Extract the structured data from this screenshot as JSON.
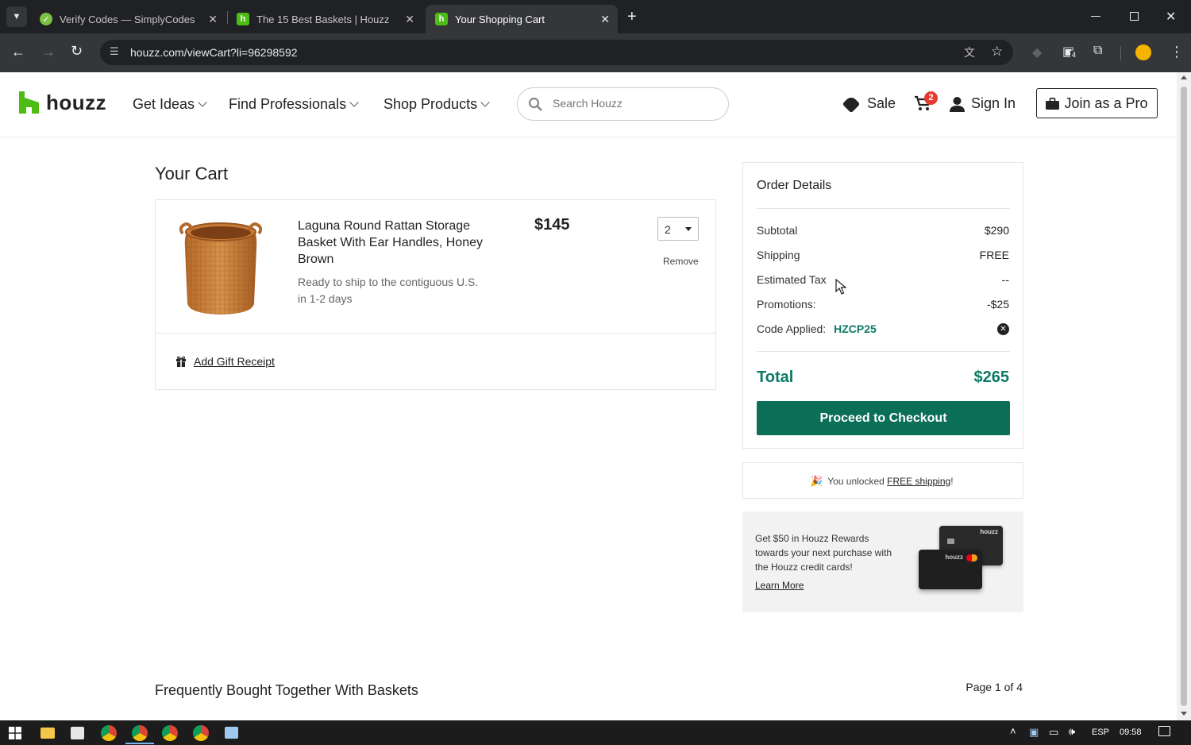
{
  "browser": {
    "tabs": [
      {
        "title": "Verify Codes — SimplyCodes",
        "icon": "simplycodes-icon"
      },
      {
        "title": "The 15 Best Baskets | Houzz",
        "icon": "houzz-icon"
      },
      {
        "title": "Your Shopping Cart",
        "icon": "houzz-icon",
        "active": true
      }
    ],
    "url": "houzz.com/viewCart?li=96298592",
    "extension_badge": "4"
  },
  "header": {
    "logo": "houzz",
    "nav": [
      "Get Ideas",
      "Find Professionals",
      "Shop Products"
    ],
    "search_placeholder": "Search Houzz",
    "sale": "Sale",
    "cart_count": "2",
    "sign_in": "Sign In",
    "join_pro": "Join as a Pro"
  },
  "cart": {
    "title": "Your Cart",
    "item": {
      "name": "Laguna Round Rattan Storage Basket With Ear Handles, Honey Brown",
      "shipping": "Ready to ship to the contiguous U.S. in 1-2 days",
      "price": "$145",
      "quantity": "2",
      "remove": "Remove"
    },
    "gift_receipt": "Add Gift Receipt"
  },
  "order": {
    "title": "Order Details",
    "rows": [
      {
        "label": "Subtotal",
        "value": "$290"
      },
      {
        "label": "Shipping",
        "value": "FREE"
      },
      {
        "label": "Estimated Tax",
        "value": "--"
      },
      {
        "label": "Promotions:",
        "value": "-$25"
      }
    ],
    "code_label": "Code Applied:",
    "code": "HZCP25",
    "total_label": "Total",
    "total": "$265",
    "checkout": "Proceed to Checkout"
  },
  "shipping_banner": {
    "prefix": "You unlocked ",
    "link": "FREE shipping",
    "suffix": "!"
  },
  "rewards": {
    "text": "Get $50 in Houzz Rewards towards your next purchase with the Houzz credit cards!",
    "link": "Learn More",
    "card_brand": "houzz"
  },
  "fbt": {
    "title": "Frequently Bought Together With Baskets",
    "page": "Page 1 of 4"
  },
  "taskbar": {
    "lang": "ESP",
    "time": "09:58"
  },
  "colors": {
    "brand_green": "#4dbc15",
    "checkout_green": "#0b6e56",
    "accent_teal": "#0b7a64",
    "badge_red": "#e63a2e"
  }
}
